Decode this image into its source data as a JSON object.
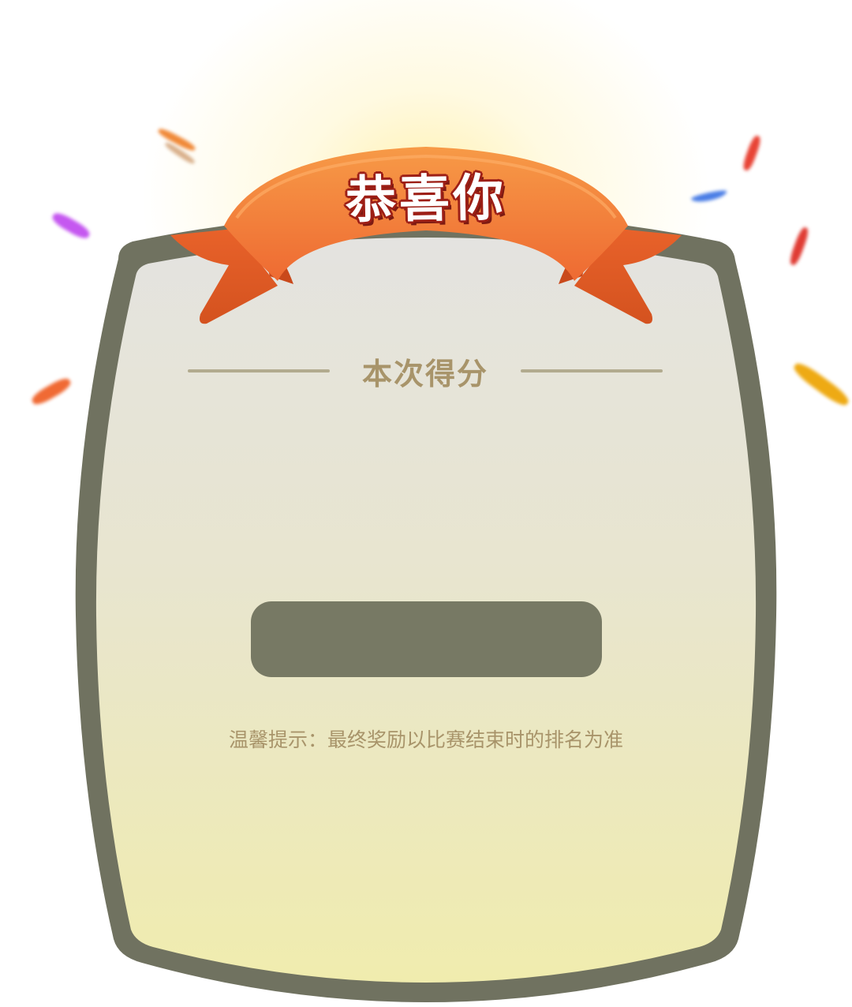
{
  "banner": {
    "title": "恭喜你"
  },
  "panel": {
    "heading": "本次得分",
    "score": "",
    "tip": "温馨提示：最终奖励以比赛结束时的排名为准"
  },
  "colors": {
    "frame": "#707260",
    "panel_top": "#e4e3e0",
    "panel_bottom": "#f0ecae",
    "ribbon": "#f27838",
    "accent_text": "#a8946a",
    "score_bar": "#777964"
  },
  "decorations": {
    "confetti": [
      "orange",
      "purple",
      "red",
      "blue",
      "yellow"
    ]
  }
}
